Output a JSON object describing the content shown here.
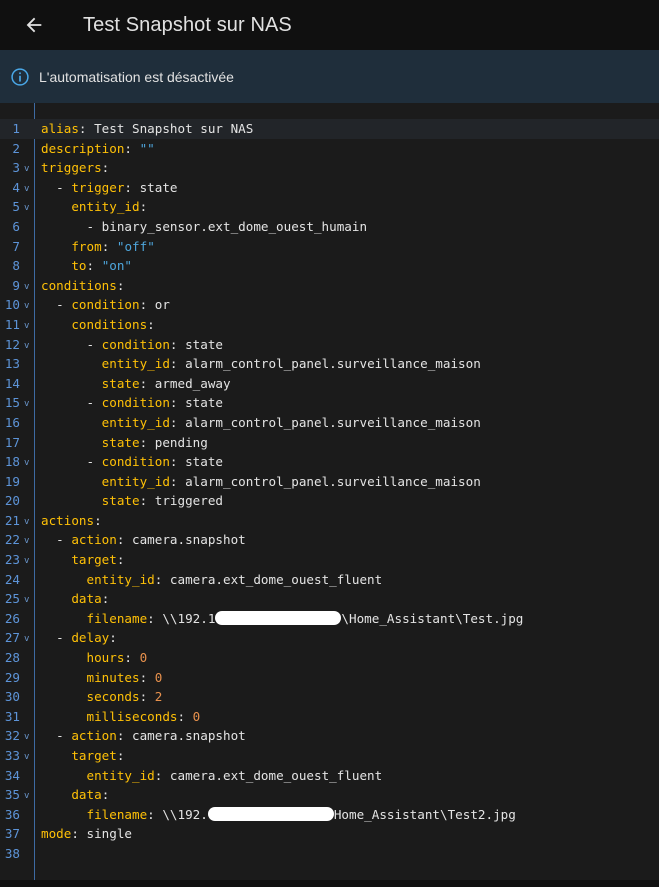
{
  "header": {
    "title": "Test Snapshot sur NAS",
    "back_icon": "arrow-left-icon"
  },
  "banner": {
    "text": "L'automatisation est désactivée",
    "icon": "info-icon"
  },
  "editor": {
    "lines": [
      {
        "n": "1",
        "fold": false,
        "parts": [
          [
            "k",
            "alias"
          ],
          [
            "p",
            ": "
          ],
          [
            "v",
            "Test Snapshot sur NAS"
          ]
        ]
      },
      {
        "n": "2",
        "fold": false,
        "parts": [
          [
            "k",
            "description"
          ],
          [
            "p",
            ": "
          ],
          [
            "s",
            "\"\""
          ]
        ]
      },
      {
        "n": "3",
        "fold": true,
        "parts": [
          [
            "k",
            "triggers"
          ],
          [
            "p",
            ":"
          ]
        ]
      },
      {
        "n": "4",
        "fold": true,
        "parts": [
          [
            "p",
            "  - "
          ],
          [
            "k",
            "trigger"
          ],
          [
            "p",
            ": "
          ],
          [
            "v",
            "state"
          ]
        ]
      },
      {
        "n": "5",
        "fold": true,
        "parts": [
          [
            "p",
            "    "
          ],
          [
            "k",
            "entity_id"
          ],
          [
            "p",
            ":"
          ]
        ]
      },
      {
        "n": "6",
        "fold": false,
        "parts": [
          [
            "p",
            "      - "
          ],
          [
            "v",
            "binary_sensor.ext_dome_ouest_humain"
          ]
        ]
      },
      {
        "n": "7",
        "fold": false,
        "parts": [
          [
            "p",
            "    "
          ],
          [
            "k",
            "from"
          ],
          [
            "p",
            ": "
          ],
          [
            "s",
            "\"off\""
          ]
        ]
      },
      {
        "n": "8",
        "fold": false,
        "parts": [
          [
            "p",
            "    "
          ],
          [
            "k",
            "to"
          ],
          [
            "p",
            ": "
          ],
          [
            "s",
            "\"on\""
          ]
        ]
      },
      {
        "n": "9",
        "fold": true,
        "parts": [
          [
            "k",
            "conditions"
          ],
          [
            "p",
            ":"
          ]
        ]
      },
      {
        "n": "10",
        "fold": true,
        "parts": [
          [
            "p",
            "  - "
          ],
          [
            "k",
            "condition"
          ],
          [
            "p",
            ": "
          ],
          [
            "v",
            "or"
          ]
        ]
      },
      {
        "n": "11",
        "fold": true,
        "parts": [
          [
            "p",
            "    "
          ],
          [
            "k",
            "conditions"
          ],
          [
            "p",
            ":"
          ]
        ]
      },
      {
        "n": "12",
        "fold": true,
        "parts": [
          [
            "p",
            "      - "
          ],
          [
            "k",
            "condition"
          ],
          [
            "p",
            ": "
          ],
          [
            "v",
            "state"
          ]
        ]
      },
      {
        "n": "13",
        "fold": false,
        "parts": [
          [
            "p",
            "        "
          ],
          [
            "k",
            "entity_id"
          ],
          [
            "p",
            ": "
          ],
          [
            "v",
            "alarm_control_panel.surveillance_maison"
          ]
        ]
      },
      {
        "n": "14",
        "fold": false,
        "parts": [
          [
            "p",
            "        "
          ],
          [
            "k",
            "state"
          ],
          [
            "p",
            ": "
          ],
          [
            "v",
            "armed_away"
          ]
        ]
      },
      {
        "n": "15",
        "fold": true,
        "parts": [
          [
            "p",
            "      - "
          ],
          [
            "k",
            "condition"
          ],
          [
            "p",
            ": "
          ],
          [
            "v",
            "state"
          ]
        ]
      },
      {
        "n": "16",
        "fold": false,
        "parts": [
          [
            "p",
            "        "
          ],
          [
            "k",
            "entity_id"
          ],
          [
            "p",
            ": "
          ],
          [
            "v",
            "alarm_control_panel.surveillance_maison"
          ]
        ]
      },
      {
        "n": "17",
        "fold": false,
        "parts": [
          [
            "p",
            "        "
          ],
          [
            "k",
            "state"
          ],
          [
            "p",
            ": "
          ],
          [
            "v",
            "pending"
          ]
        ]
      },
      {
        "n": "18",
        "fold": true,
        "parts": [
          [
            "p",
            "      - "
          ],
          [
            "k",
            "condition"
          ],
          [
            "p",
            ": "
          ],
          [
            "v",
            "state"
          ]
        ]
      },
      {
        "n": "19",
        "fold": false,
        "parts": [
          [
            "p",
            "        "
          ],
          [
            "k",
            "entity_id"
          ],
          [
            "p",
            ": "
          ],
          [
            "v",
            "alarm_control_panel.surveillance_maison"
          ]
        ]
      },
      {
        "n": "20",
        "fold": false,
        "parts": [
          [
            "p",
            "        "
          ],
          [
            "k",
            "state"
          ],
          [
            "p",
            ": "
          ],
          [
            "v",
            "triggered"
          ]
        ]
      },
      {
        "n": "21",
        "fold": true,
        "parts": [
          [
            "k",
            "actions"
          ],
          [
            "p",
            ":"
          ]
        ]
      },
      {
        "n": "22",
        "fold": true,
        "parts": [
          [
            "p",
            "  - "
          ],
          [
            "k",
            "action"
          ],
          [
            "p",
            ": "
          ],
          [
            "v",
            "camera.snapshot"
          ]
        ]
      },
      {
        "n": "23",
        "fold": true,
        "parts": [
          [
            "p",
            "    "
          ],
          [
            "k",
            "target"
          ],
          [
            "p",
            ":"
          ]
        ]
      },
      {
        "n": "24",
        "fold": false,
        "parts": [
          [
            "p",
            "      "
          ],
          [
            "k",
            "entity_id"
          ],
          [
            "p",
            ": "
          ],
          [
            "v",
            "camera.ext_dome_ouest_fluent"
          ]
        ]
      },
      {
        "n": "25",
        "fold": true,
        "parts": [
          [
            "p",
            "    "
          ],
          [
            "k",
            "data"
          ],
          [
            "p",
            ":"
          ]
        ]
      },
      {
        "n": "26",
        "fold": false,
        "parts": [
          [
            "p",
            "      "
          ],
          [
            "k",
            "filename"
          ],
          [
            "p",
            ": "
          ],
          [
            "v",
            "\\\\192.1"
          ],
          [
            "r",
            ""
          ],
          [
            "v",
            "\\Home_Assistant\\Test.jpg"
          ]
        ]
      },
      {
        "n": "27",
        "fold": true,
        "parts": [
          [
            "p",
            "  - "
          ],
          [
            "k",
            "delay"
          ],
          [
            "p",
            ":"
          ]
        ]
      },
      {
        "n": "28",
        "fold": false,
        "parts": [
          [
            "p",
            "      "
          ],
          [
            "k",
            "hours"
          ],
          [
            "p",
            ": "
          ],
          [
            "n",
            "0"
          ]
        ]
      },
      {
        "n": "29",
        "fold": false,
        "parts": [
          [
            "p",
            "      "
          ],
          [
            "k",
            "minutes"
          ],
          [
            "p",
            ": "
          ],
          [
            "n",
            "0"
          ]
        ]
      },
      {
        "n": "30",
        "fold": false,
        "parts": [
          [
            "p",
            "      "
          ],
          [
            "k",
            "seconds"
          ],
          [
            "p",
            ": "
          ],
          [
            "n",
            "2"
          ]
        ]
      },
      {
        "n": "31",
        "fold": false,
        "parts": [
          [
            "p",
            "      "
          ],
          [
            "k",
            "milliseconds"
          ],
          [
            "p",
            ": "
          ],
          [
            "n",
            "0"
          ]
        ]
      },
      {
        "n": "32",
        "fold": true,
        "parts": [
          [
            "p",
            "  - "
          ],
          [
            "k",
            "action"
          ],
          [
            "p",
            ": "
          ],
          [
            "v",
            "camera.snapshot"
          ]
        ]
      },
      {
        "n": "33",
        "fold": true,
        "parts": [
          [
            "p",
            "    "
          ],
          [
            "k",
            "target"
          ],
          [
            "p",
            ":"
          ]
        ]
      },
      {
        "n": "34",
        "fold": false,
        "parts": [
          [
            "p",
            "      "
          ],
          [
            "k",
            "entity_id"
          ],
          [
            "p",
            ": "
          ],
          [
            "v",
            "camera.ext_dome_ouest_fluent"
          ]
        ]
      },
      {
        "n": "35",
        "fold": true,
        "parts": [
          [
            "p",
            "    "
          ],
          [
            "k",
            "data"
          ],
          [
            "p",
            ":"
          ]
        ]
      },
      {
        "n": "36",
        "fold": false,
        "parts": [
          [
            "p",
            "      "
          ],
          [
            "k",
            "filename"
          ],
          [
            "p",
            ": "
          ],
          [
            "v",
            "\\\\192."
          ],
          [
            "r",
            ""
          ],
          [
            "v",
            "Home_Assistant\\Test2.jpg"
          ]
        ]
      },
      {
        "n": "37",
        "fold": false,
        "parts": [
          [
            "k",
            "mode"
          ],
          [
            "p",
            ": "
          ],
          [
            "v",
            "single"
          ]
        ]
      },
      {
        "n": "38",
        "fold": false,
        "parts": []
      }
    ]
  },
  "colors": {
    "key": "#ffc107",
    "string": "#4ea6dc",
    "number": "#e8914d",
    "gutter_line": "#3e6ba3",
    "banner_bg": "#1f2e3b"
  }
}
